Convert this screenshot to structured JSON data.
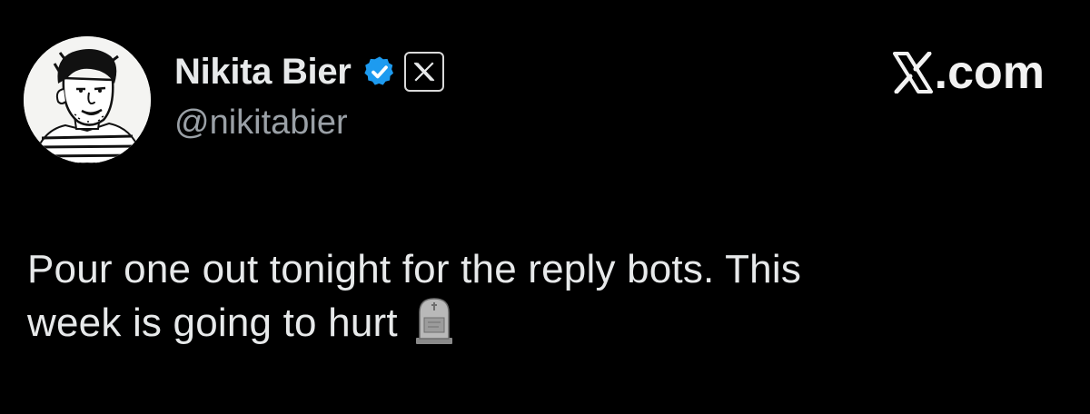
{
  "tweet": {
    "author": {
      "display_name": "Nikita Bier",
      "handle": "@nikitabier",
      "verified_icon": "verified-check-icon",
      "affiliate_icon": "x-logo-icon"
    },
    "text_line1": "Pour one out tonight for the reply bots. This",
    "text_line2": "week is going to hurt",
    "emoji": "tombstone-icon"
  },
  "watermark": {
    "label": ".com",
    "icon": "x-logo-icon"
  },
  "colors": {
    "background": "#000000",
    "text": "#e7e9ea",
    "handle": "#9aa0a6",
    "verified": "#1d9bf0"
  }
}
